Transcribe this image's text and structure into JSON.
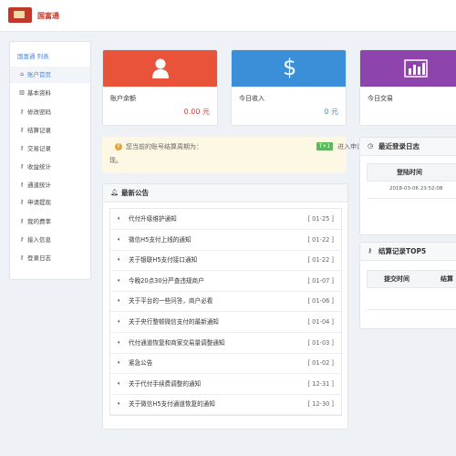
{
  "header": {
    "brand": "国富通"
  },
  "sidebar": {
    "title": "国富通  列表",
    "items": [
      {
        "icon": "home-icon",
        "glyph": "⌂",
        "label": "账户首页"
      },
      {
        "icon": "bar-chart-icon",
        "glyph": "▥",
        "label": "基本资料"
      },
      {
        "icon": "key-icon",
        "glyph": "⚷",
        "label": "修改密码"
      },
      {
        "icon": "key-icon",
        "glyph": "⚷",
        "label": "结算记录"
      },
      {
        "icon": "key-icon",
        "glyph": "⚷",
        "label": "交易记录"
      },
      {
        "icon": "key-icon",
        "glyph": "⚷",
        "label": "收益统计"
      },
      {
        "icon": "key-icon",
        "glyph": "⚷",
        "label": "通道统计"
      },
      {
        "icon": "key-icon",
        "glyph": "⚷",
        "label": "申请提现"
      },
      {
        "icon": "key-icon",
        "glyph": "⚷",
        "label": "我的费率"
      },
      {
        "icon": "key-icon",
        "glyph": "⚷",
        "label": "接入信息"
      },
      {
        "icon": "key-icon",
        "glyph": "⚷",
        "label": "登录日志"
      }
    ]
  },
  "cards": [
    {
      "label": "账户余额",
      "value": "0.00 元",
      "color": "#e8533a",
      "value_color": "#e23b2e",
      "icon": "user-icon"
    },
    {
      "label": "今日收入",
      "value": "0 元",
      "color": "#3b8fd9",
      "value_color": "#3b8fd9",
      "icon": "dollar-icon"
    },
    {
      "label": "今日交易",
      "value": "",
      "color": "#8e44ad",
      "value_color": "#8e44ad",
      "icon": "chart-icon"
    }
  ],
  "notice": {
    "text1": "您当前的账号结算周期为：",
    "badge": "T+1",
    "text2": "进入申请结算才可以划入余额提",
    "text3": "现。"
  },
  "announcements": {
    "title": "最新公告",
    "items": [
      {
        "title": "代付升级维护通知",
        "date": "[ 01-25 ]"
      },
      {
        "title": "微信H5支付上线的通知",
        "date": "[ 01-22 ]"
      },
      {
        "title": "关于银联H5支付接口通知",
        "date": "[ 01-22 ]"
      },
      {
        "title": "今晚20点30分严查违规商户",
        "date": "[ 01-07 ]"
      },
      {
        "title": "关于平台的一些问答，商户必看",
        "date": "[ 01-06 ]"
      },
      {
        "title": "关于央行整顿微信支付的最新通知",
        "date": "[ 01-04 ]"
      },
      {
        "title": "代付通道恢复和商家交易量调整通知",
        "date": "[ 01-03 ]"
      },
      {
        "title": "紧急公告",
        "date": "[ 01-02 ]"
      },
      {
        "title": "关于代付手续费调整的通知",
        "date": "[ 12-31 ]"
      },
      {
        "title": "关于微信H5支付通道恢复的通知",
        "date": "[ 12-30 ]"
      }
    ]
  },
  "login_log": {
    "title": "最近登录日志",
    "column": "登陆时间",
    "rows": [
      "2018-03-06 23:52:08"
    ]
  },
  "settle_top": {
    "title": "结算记录TOP5",
    "columns": [
      "提交时间",
      "结算"
    ]
  }
}
